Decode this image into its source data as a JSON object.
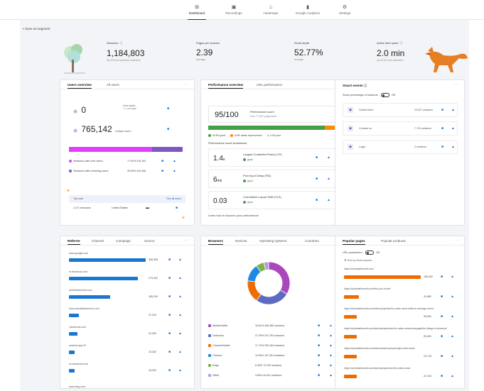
{
  "nav": [
    {
      "label": "Dashboard",
      "icon": "dashboard-icon",
      "glyph": "⊞",
      "active": true
    },
    {
      "label": "Recordings",
      "icon": "camera-icon",
      "glyph": "▣"
    },
    {
      "label": "Heatmaps",
      "icon": "flame-icon",
      "glyph": "♨"
    },
    {
      "label": "Google Analytics",
      "icon": "analytics-icon",
      "glyph": "▮"
    },
    {
      "label": "Settings",
      "icon": "gear-icon",
      "glyph": "⚙"
    }
  ],
  "save_segment": "Save as segment",
  "kpis": [
    {
      "title": "Sessions",
      "value": "1,184,803",
      "sub": "36,475 bot sessions excluded"
    },
    {
      "title": "Pages per session",
      "value": "2.39",
      "sub": "average"
    },
    {
      "title": "Scroll depth",
      "value": "52.77%",
      "sub": "average"
    },
    {
      "title": "Active time spent",
      "value": "2.0 min",
      "sub": "out of 5.5 min total time"
    }
  ],
  "users": {
    "tabs": [
      "Users overview",
      "All users"
    ],
    "live_value": "0",
    "live_label": "Live users",
    "live_sub": "1.1 average",
    "unique_value": "765,142",
    "unique_label": "Unique users",
    "bar_new_pct": 73,
    "legend": [
      {
        "label": "Sessions with new users",
        "value": "77.61%  919,762",
        "color": "#e040fb"
      },
      {
        "label": "Sessions with returning users",
        "value": "28.99%  342,408",
        "color": "#7e57c2"
      }
    ],
    "top_user_label": "Top user",
    "see_all": "See all users",
    "top_user_sessions": "1.4 K sessions",
    "top_user_country": "United States"
  },
  "performance": {
    "tabs": [
      "Performance overview",
      "URL performance"
    ],
    "score": "95/100",
    "score_label": "Performance score",
    "score_sub": "from 77,567 pageviews",
    "bar": {
      "good_pct": 90,
      "improve_pct": 9
    },
    "legend": [
      "90.8% good",
      "8.6% needs improvement",
      "0.3% poor"
    ],
    "breakdown_title": "Performance score breakdown",
    "metrics": [
      {
        "value": "1.4",
        "unit": "s",
        "name": "Largest Contentful Paint (LCP)",
        "status": "good"
      },
      {
        "value": "6",
        "unit": "ms",
        "name": "First Input Delay (FID)",
        "status": "good"
      },
      {
        "value": "0.03",
        "unit": "",
        "name": "Cumulative Layout Shift (CLS)",
        "status": "good"
      }
    ],
    "link": "Learn how to improve your performance"
  },
  "smart": {
    "title": "Smart events",
    "toggle_label": "Show percentage of sessions",
    "toggle_state": "Off",
    "items": [
      {
        "name": "Submit form",
        "value": "10,027 sessions"
      },
      {
        "name": "Contact us",
        "value": "7,716 sessions"
      },
      {
        "name": "Login",
        "value": "2 sessions"
      }
    ]
  },
  "referrer": {
    "tabs": [
      "Referrer",
      "Channel",
      "Campaign",
      "Source"
    ],
    "rows": [
      {
        "label": "www.google.com",
        "value": "306,308",
        "fraction": 1.0
      },
      {
        "label": "m.facebook.com",
        "value": "273,302",
        "fraction": 0.9
      },
      {
        "label": "dorebatelemedi.com",
        "value": "165,100",
        "fraction": 0.54
      },
      {
        "label": "www.doreliaatelemoni.com",
        "value": "37,910",
        "fraction": 0.13
      },
      {
        "label": "l.facebook.com",
        "value": "31,002",
        "fraction": 0.11
      },
      {
        "label": "android-app://0",
        "value": "15,302",
        "fraction": 0.07
      },
      {
        "label": "lm.facebook.com",
        "value": "15,302",
        "fraction": 0.07
      }
    ],
    "footer_row": "www.bing.com"
  },
  "browsers": {
    "tabs": [
      "Browsers",
      "Devices",
      "Operating systems",
      "Countries"
    ],
    "rows": [
      {
        "label": "MobileSafari",
        "value": "34.81%  408,380 sessions",
        "color": "#ab47bc"
      },
      {
        "label": "Unknown",
        "value": "27.09%  321,763 sessions",
        "color": "#5c6bc0"
      },
      {
        "label": "ChromeMobile",
        "value": "17.70%  209,163 sessions",
        "color": "#ef6c00"
      },
      {
        "label": "Chrome",
        "value": "13.95%  167,261 sessions",
        "color": "#1e88e5"
      },
      {
        "label": "Edge",
        "value": "6.35%  73,762 sessions",
        "color": "#7cb342"
      },
      {
        "label": "Other",
        "value": "3.80%  44,991 sessions",
        "color": "#b39ddb"
      }
    ]
  },
  "pages": {
    "tabs": [
      "Popular pages",
      "Popular products"
    ],
    "toggle_label": "URL parameters",
    "toggle_state": "Off",
    "sort_label": "Sort by Most popular",
    "rows": [
      {
        "label": "https://dorebatelemedi.com/",
        "value": "168,302",
        "fraction": 1.0
      },
      {
        "label": "https://dorebatelemedi.com/find-your-home/",
        "value": "31,881",
        "fraction": 0.19
      },
      {
        "label": "https://dorebatelemedi.com/index/properties/ho-meter-area-while-for-average-home/",
        "value": "28,381",
        "fraction": 0.17
      },
      {
        "label": "https://dorebatelemedi.com/index/perspectives/ho-meter-area/homepage/the-village-of-bohemia/",
        "value": "26,481",
        "fraction": 0.16
      },
      {
        "label": "https://dorebatelemedi.com/index/academy/homestyle-meter-area/",
        "value": "24,715",
        "fraction": 0.15
      },
      {
        "label": "https://dorebatelemedi.com/index/perspectives/ho-meter-area/",
        "value": "22,104",
        "fraction": 0.13
      }
    ]
  }
}
